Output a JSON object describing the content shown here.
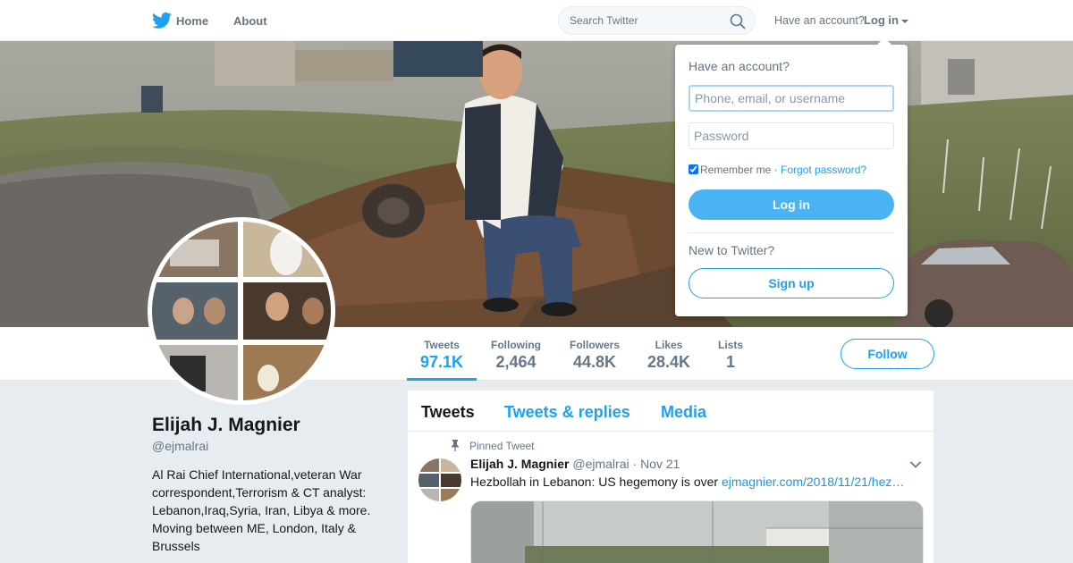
{
  "nav": {
    "home": "Home",
    "about": "About",
    "search_placeholder": "Search Twitter",
    "have_account": "Have an account?",
    "login": "Log in"
  },
  "profile": {
    "name": "Elijah J. Magnier",
    "handle": "@ejmalrai",
    "bio": "Al Rai Chief International,veteran War correspondent,Terrorism & CT analyst: Lebanon,Iraq,Syria, Iran, Libya & more. Moving between ME, London, Italy & Brussels"
  },
  "stats": [
    {
      "label": "Tweets",
      "value": "97.1K"
    },
    {
      "label": "Following",
      "value": "2,464"
    },
    {
      "label": "Followers",
      "value": "44.8K"
    },
    {
      "label": "Likes",
      "value": "28.4K"
    },
    {
      "label": "Lists",
      "value": "1"
    }
  ],
  "follow_label": "Follow",
  "timeline": {
    "tabs": [
      "Tweets",
      "Tweets & replies",
      "Media"
    ],
    "pinned_label": "Pinned Tweet",
    "tweet": {
      "name": "Elijah J. Magnier",
      "handle": "@ejmalrai",
      "date": "Nov 21",
      "text": "Hezbollah in Lebanon: US hegemony is over ",
      "link": "ejmagnier.com/2018/11/21/hez…"
    }
  },
  "login_dropdown": {
    "title": "Have an account?",
    "username_placeholder": "Phone, email, or username",
    "password_placeholder": "Password",
    "remember": "Remember me",
    "separator": " · ",
    "forgot": "Forgot password?",
    "login_button": "Log in",
    "new_prompt": "New to Twitter?",
    "signup_button": "Sign up"
  },
  "colors": {
    "accent": "#1da1f2",
    "background": "#e6ecf0"
  }
}
